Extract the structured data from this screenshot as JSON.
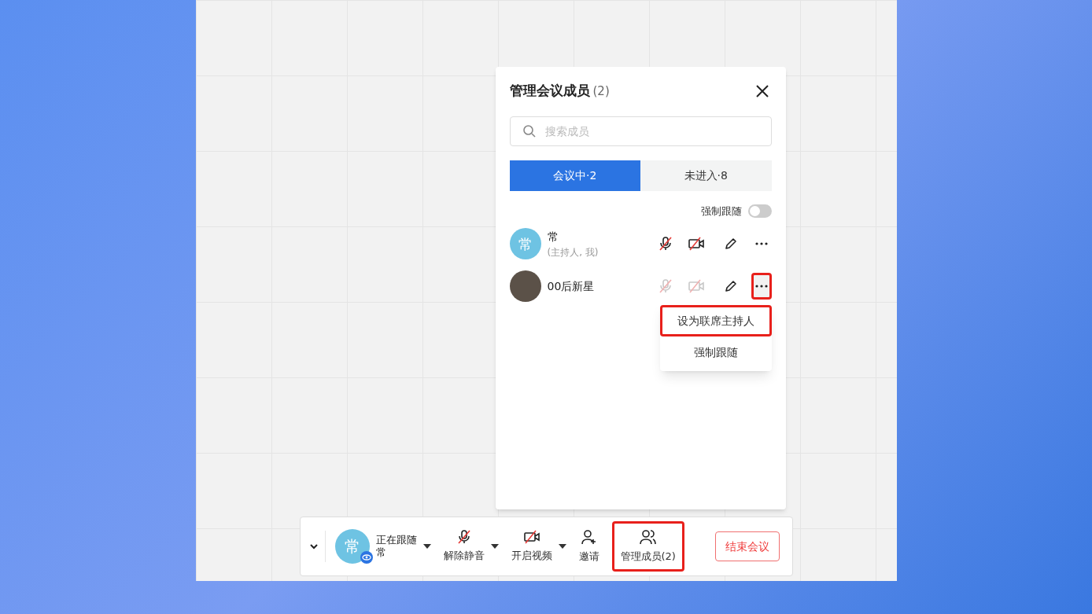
{
  "panel": {
    "title": "管理会议成员",
    "count": "(2)",
    "search": {
      "placeholder": "搜索成员"
    },
    "tabs": [
      {
        "label": "会议中·2",
        "selected": true
      },
      {
        "label": "未进入·8",
        "selected": false
      }
    ],
    "force_follow": {
      "label": "强制跟随",
      "on": false
    },
    "members": [
      {
        "avatar_text": "常",
        "name": "常",
        "note": "(主持人, 我)",
        "controls_disabled": false,
        "highlighted": false
      },
      {
        "name": "00后新星",
        "controls_disabled": true,
        "highlighted": true,
        "menu": [
          {
            "label": "设为联席主持人",
            "highlighted": true
          },
          {
            "label": "强制跟随",
            "highlighted": false
          }
        ]
      }
    ]
  },
  "toolbar": {
    "follow": {
      "avatar_text": "常",
      "status": "正在跟随",
      "name": "常"
    },
    "buttons": [
      {
        "kind": "mic",
        "label": "解除静音",
        "caret": true,
        "highlighted": false
      },
      {
        "kind": "video",
        "label": "开启视频",
        "caret": true,
        "highlighted": false
      },
      {
        "kind": "invite",
        "label": "邀请",
        "caret": false,
        "highlighted": false
      },
      {
        "kind": "members",
        "label": "管理成员(2)",
        "caret": false,
        "highlighted": true
      }
    ],
    "end": "结束会议"
  }
}
